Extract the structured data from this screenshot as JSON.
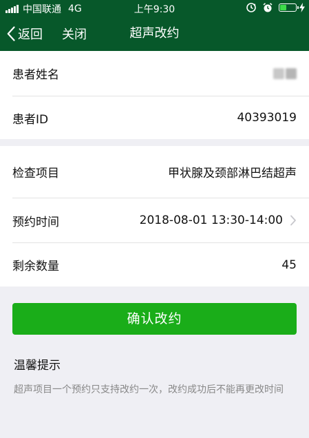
{
  "status_bar": {
    "carrier": "中国联通",
    "network": "4G",
    "time": "上午9:30",
    "battery_level": 0.4
  },
  "nav": {
    "back_label": "返回",
    "close_label": "关闭",
    "title": "超声改约"
  },
  "patient": {
    "name_label": "患者姓名",
    "id_label": "患者ID",
    "id_value": "40393019"
  },
  "exam": {
    "item_label": "检查项目",
    "item_value": "甲状腺及颈部淋巴结超声",
    "time_label": "预约时间",
    "time_value": "2018-08-01 13:30-14:00",
    "remain_label": "剩余数量",
    "remain_value": "45"
  },
  "confirm_label": "确认改约",
  "tips": {
    "title": "温馨提示",
    "text": "超声项目一个预约只支持改约一次，改约成功后不能再更改时间"
  },
  "colors": {
    "header_bg": "#07582a",
    "confirm_bg": "#1aad19",
    "page_bg": "#efeff4"
  },
  "icons": [
    "signal-icon",
    "alarm-sync-icon",
    "alarm-clock-icon",
    "battery-icon",
    "charging-bolt-icon",
    "back-chevron-icon",
    "chevron-right-icon"
  ]
}
